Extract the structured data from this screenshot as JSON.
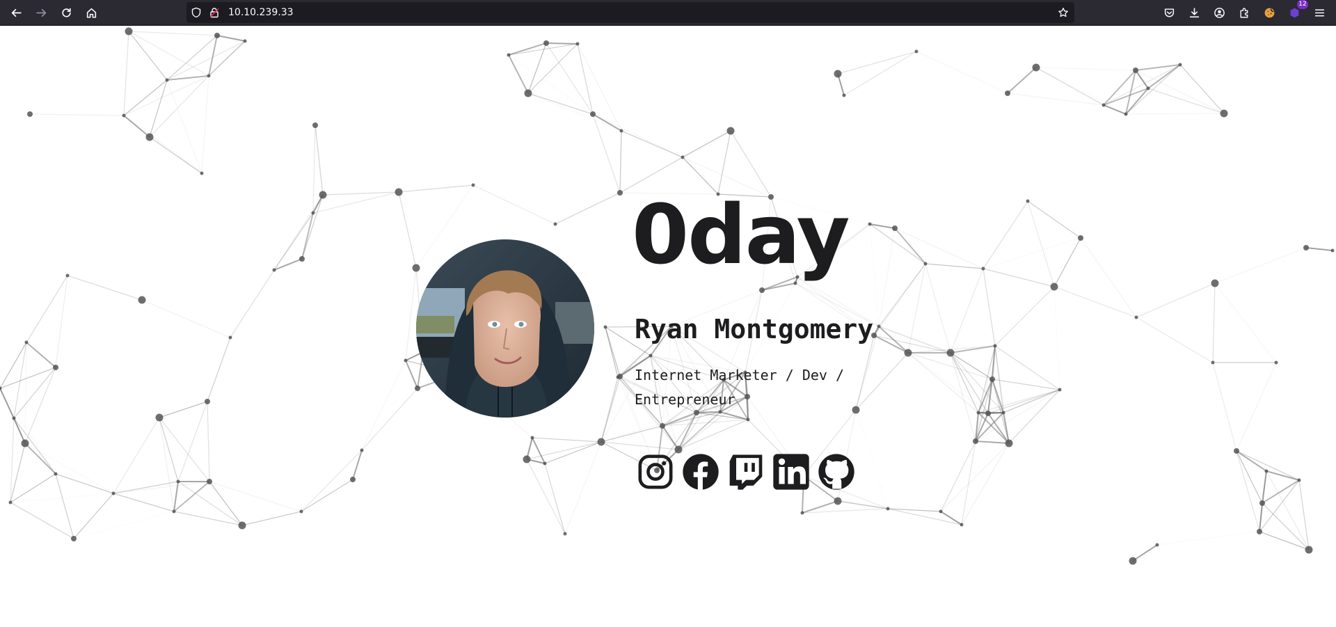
{
  "browser": {
    "url": "10.10.239.33",
    "extensions_badge": "12"
  },
  "page": {
    "title": "0day",
    "name": "Ryan Montgomery",
    "tagline": "Internet Marketer / Dev / Entrepreneur",
    "social_links": [
      {
        "name": "instagram",
        "icon": "instagram-icon"
      },
      {
        "name": "facebook",
        "icon": "facebook-icon"
      },
      {
        "name": "twitch",
        "icon": "twitch-icon"
      },
      {
        "name": "linkedin",
        "icon": "linkedin-icon"
      },
      {
        "name": "github",
        "icon": "github-icon"
      }
    ]
  },
  "colors": {
    "toolbar_bg": "#2b2a33",
    "urlbar_bg": "#1c1b22",
    "text_dark": "#1d1d1f",
    "network_line": "#777777",
    "node": "#555555"
  }
}
